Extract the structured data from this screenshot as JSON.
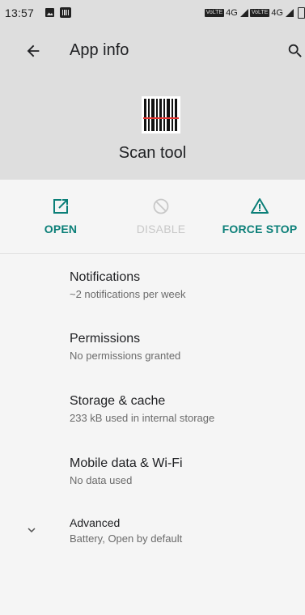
{
  "status_bar": {
    "time": "13:57",
    "volte1": "VoLTE",
    "net1": "4G",
    "volte2": "VoLTE",
    "net2": "4G"
  },
  "toolbar": {
    "title": "App info",
    "back_icon": "arrow-back-icon",
    "search_icon": "search-icon"
  },
  "app": {
    "name": "Scan tool",
    "icon": "barcode-icon"
  },
  "actions": {
    "open": "OPEN",
    "disable": "DISABLE",
    "force_stop": "FORCE STOP"
  },
  "settings": [
    {
      "title": "Notifications",
      "summary": "~2 notifications per week"
    },
    {
      "title": "Permissions",
      "summary": "No permissions granted"
    },
    {
      "title": "Storage & cache",
      "summary": "233 kB used in internal storage"
    },
    {
      "title": "Mobile data & Wi-Fi",
      "summary": "No data used"
    },
    {
      "title": "Advanced",
      "summary": "Battery, Open by default"
    }
  ],
  "colors": {
    "accent": "#0b7f78",
    "header_bg": "#dedede",
    "page_bg": "#f5f5f5",
    "disabled": "#c8c8c8"
  }
}
